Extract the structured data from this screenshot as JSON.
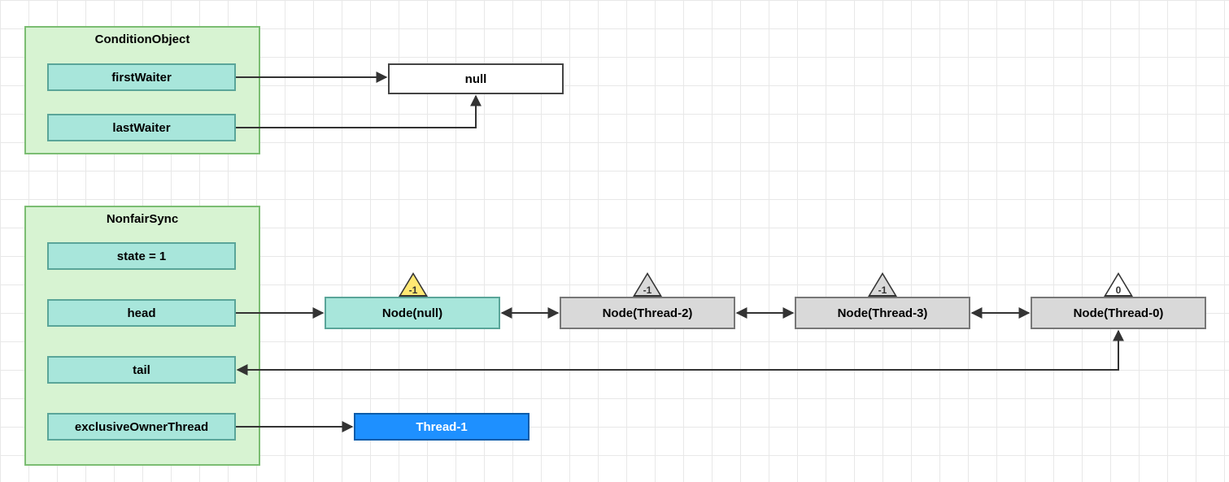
{
  "conditionObject": {
    "title": "ConditionObject",
    "fields": {
      "firstWaiter": "firstWaiter",
      "lastWaiter": "lastWaiter"
    },
    "target": "null"
  },
  "nonfairSync": {
    "title": "NonfairSync",
    "fields": {
      "state": "state = 1",
      "head": "head",
      "tail": "tail",
      "exclusiveOwnerThread": "exclusiveOwnerThread"
    }
  },
  "ownerThread": "Thread-1",
  "queue": [
    {
      "label": "Node(null)",
      "waitStatus": "-1",
      "style": "teal",
      "triStyle": "yellow"
    },
    {
      "label": "Node(Thread-2)",
      "waitStatus": "-1",
      "style": "gray",
      "triStyle": "gray"
    },
    {
      "label": "Node(Thread-3)",
      "waitStatus": "-1",
      "style": "gray",
      "triStyle": "gray"
    },
    {
      "label": "Node(Thread-0)",
      "waitStatus": "0",
      "style": "gray",
      "triStyle": "white"
    }
  ]
}
